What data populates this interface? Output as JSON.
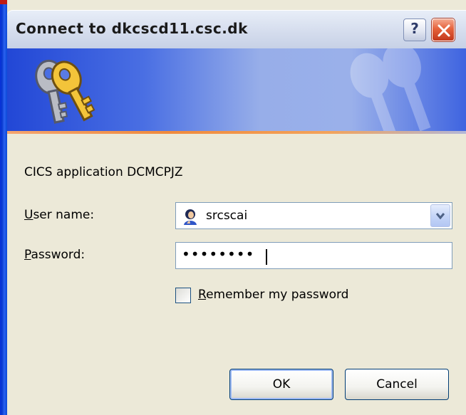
{
  "window": {
    "title": "Connect to dkcscd11.csc.dk",
    "help_label": "?",
    "icons": [
      "keys-icon",
      "help-icon",
      "close-icon",
      "user-icon",
      "chevron-down-icon"
    ]
  },
  "dialog": {
    "app_label": "CICS application DCMCPJZ",
    "username_label": "User name:",
    "username_value": "srcscai",
    "password_label": "Password:",
    "password_masked": "••••••••",
    "remember_label": "Remember my password",
    "remember_checked": false
  },
  "buttons": {
    "ok": "OK",
    "cancel": "Cancel"
  },
  "colors": {
    "banner_blue": "#2247d6",
    "accent_orange": "#f08a3c",
    "close_red": "#e5623b",
    "dialog_bg": "#ece9d8"
  }
}
